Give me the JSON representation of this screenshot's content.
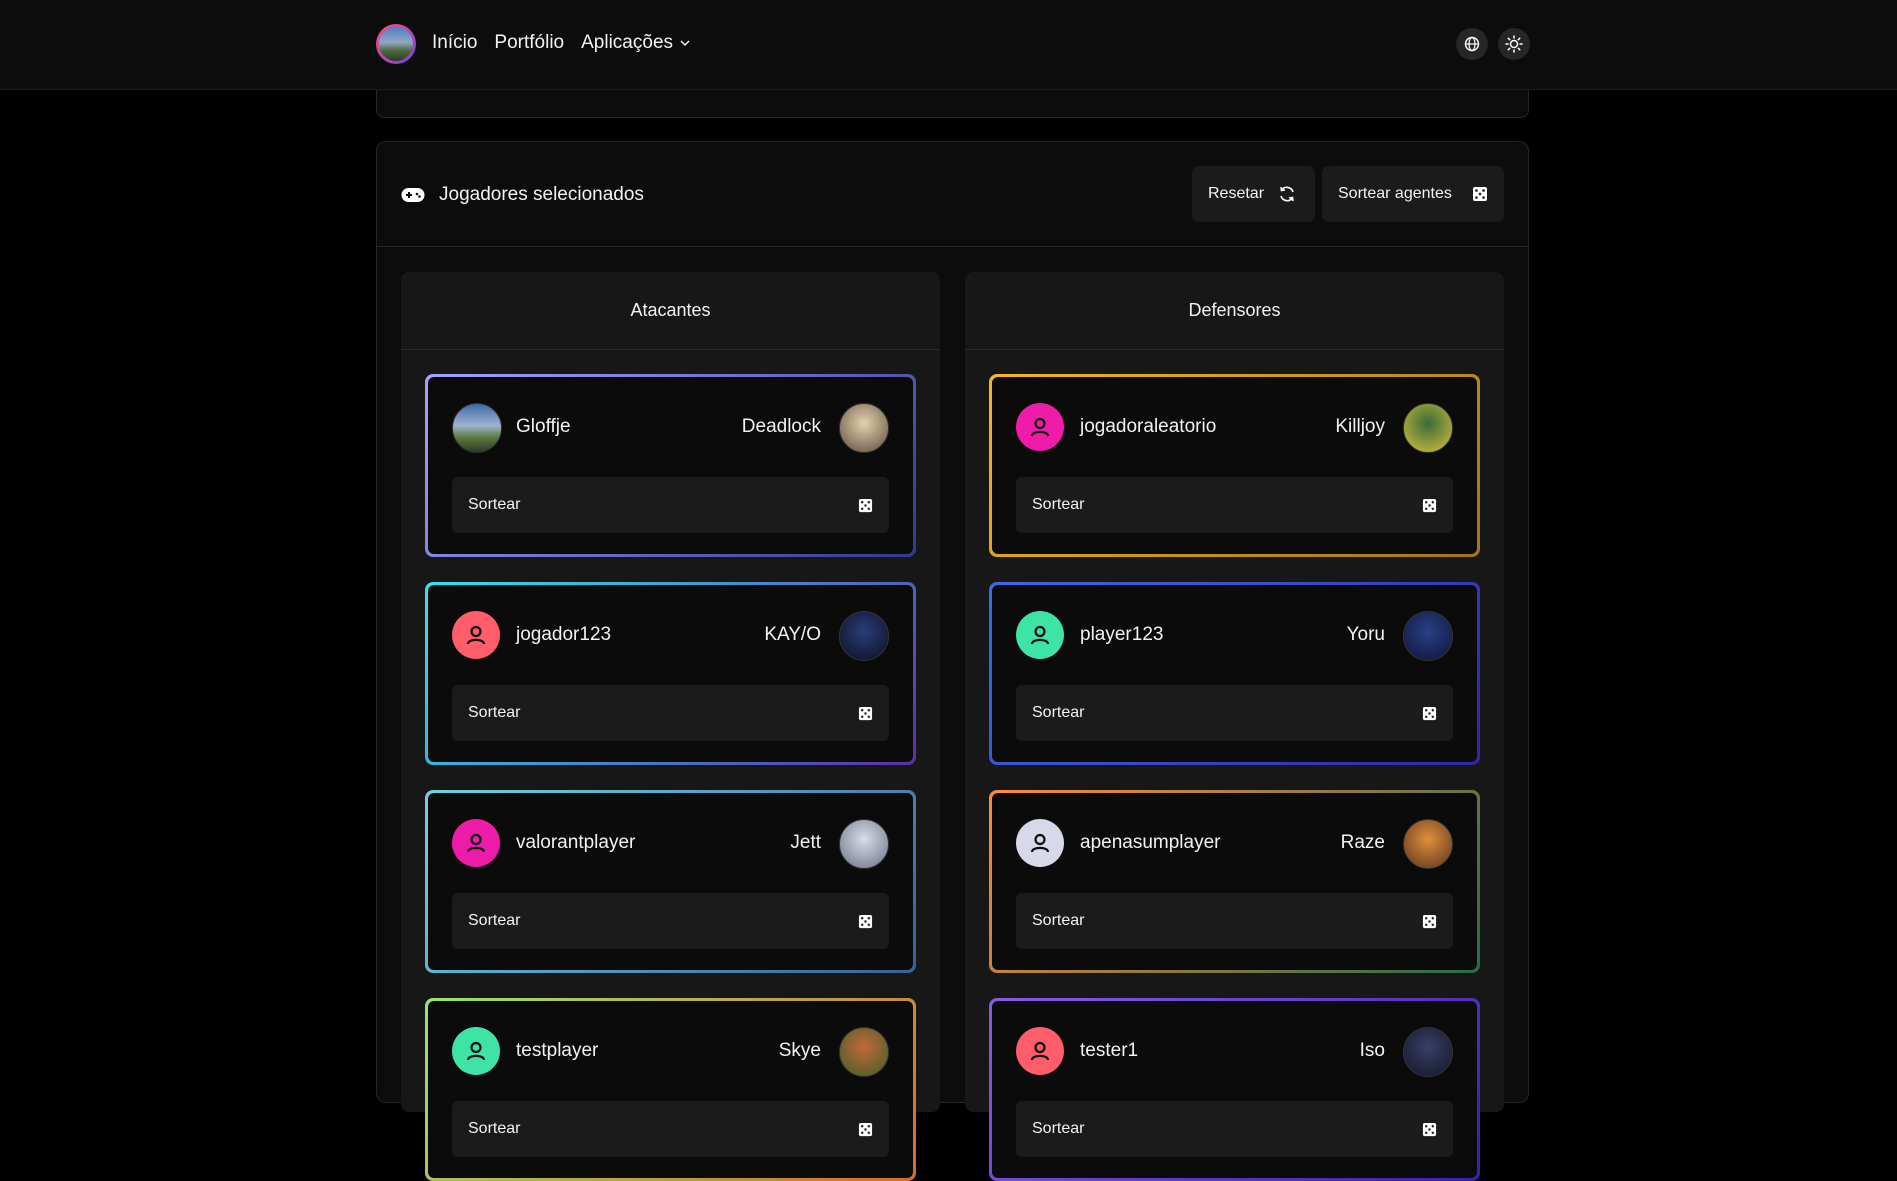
{
  "nav": {
    "links": [
      "Início",
      "Portfólio",
      "Aplicações"
    ],
    "icons": [
      "globe-icon",
      "sun-icon"
    ]
  },
  "panel": {
    "title": "Jogadores selecionados",
    "reset_label": "Resetar",
    "draw_agents_label": "Sortear agentes"
  },
  "attackers": {
    "title": "Atacantes",
    "players": [
      {
        "name": "Gloffje",
        "agent": "Deadlock",
        "avatar_type": "photo",
        "border": [
          "#a6a3ff",
          "#2f3a8f"
        ],
        "agent_color": [
          "#e5d2b0",
          "#5c4a3a"
        ]
      },
      {
        "name": "jogador123",
        "agent": "KAY/O",
        "avatar_type": "default",
        "avatar_color": "#ff5c6c",
        "border": [
          "#2ee6f0",
          "#5b2fa8"
        ],
        "agent_color": [
          "#2b3d7a",
          "#0b0f1e"
        ]
      },
      {
        "name": "valorantplayer",
        "agent": "Jett",
        "avatar_type": "default",
        "avatar_color": "#ee1ca8",
        "border": [
          "#6fd3e3",
          "#3a5f9a"
        ],
        "agent_color": [
          "#d9dce6",
          "#6a7287"
        ]
      },
      {
        "name": "testplayer",
        "agent": "Skye",
        "avatar_type": "default",
        "avatar_color": "#3ee3a6",
        "border": [
          "#9be36f",
          "#d96a2a"
        ],
        "agent_color": [
          "#c4683a",
          "#3d5e2a"
        ]
      }
    ]
  },
  "defenders": {
    "title": "Defensores",
    "players": [
      {
        "name": "jogadoraleatorio",
        "agent": "Killjoy",
        "avatar_type": "default",
        "avatar_color": "#ee1ca8",
        "border": [
          "#f6b81c",
          "#a27419"
        ],
        "agent_color": [
          "#3a6b3a",
          "#d8c23a"
        ]
      },
      {
        "name": "player123",
        "agent": "Yoru",
        "avatar_type": "default",
        "avatar_color": "#3ee3a6",
        "border": [
          "#3c6be6",
          "#3326a6"
        ],
        "agent_color": [
          "#2b3f8a",
          "#0d1533"
        ]
      },
      {
        "name": "apenasumplayer",
        "agent": "Raze",
        "avatar_type": "default",
        "avatar_color": "#d7d9e8",
        "border": [
          "#ff8c3a",
          "#2a6a4a"
        ],
        "agent_color": [
          "#e0903a",
          "#5a3220"
        ]
      },
      {
        "name": "tester1",
        "agent": "Iso",
        "avatar_type": "default",
        "avatar_color": "#ff5c6c",
        "border": [
          "#8b5ae6",
          "#3a1fb0"
        ],
        "agent_color": [
          "#3a3f66",
          "#12162a"
        ]
      }
    ]
  },
  "sortear_label": "Sortear"
}
